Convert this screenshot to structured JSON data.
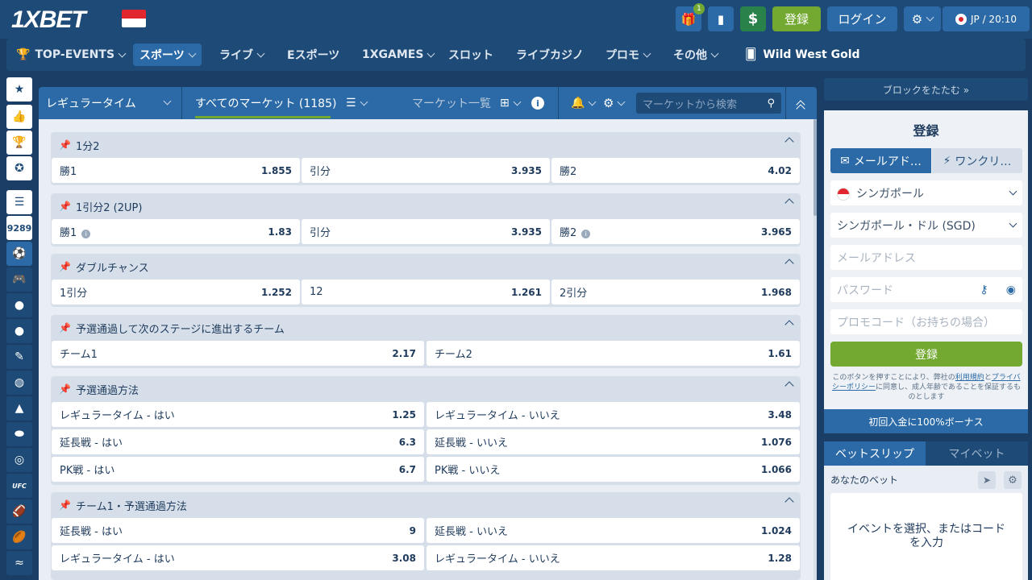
{
  "header": {
    "logo": "1XBET",
    "gift_badge": "1",
    "dollar_icon": "$",
    "register": "登録",
    "login": "ログイン",
    "lang": "JP / 20:10"
  },
  "nav": {
    "items": [
      {
        "label": "TOP-EVENTS"
      },
      {
        "label": "スポーツ"
      },
      {
        "label": "ライブ"
      },
      {
        "label": "Eスポーツ"
      },
      {
        "label": "1XGAMES"
      },
      {
        "label": "スロット"
      },
      {
        "label": "ライブカジノ"
      },
      {
        "label": "プロモ"
      },
      {
        "label": "その他"
      },
      {
        "label": "Wild West Gold"
      }
    ]
  },
  "sidebar": {
    "count": "9289",
    "ufc_label": "UFC"
  },
  "market_header": {
    "period": "レギュラータイム",
    "all_markets": "すべてのマーケット (1185)",
    "market_list": "マーケット一覧",
    "search_placeholder": "マーケットから検索"
  },
  "markets": [
    {
      "title": "1分2",
      "odds": [
        {
          "label": "勝1",
          "value": "1.855"
        },
        {
          "label": "引分",
          "value": "3.935"
        },
        {
          "label": "勝2",
          "value": "4.02"
        }
      ]
    },
    {
      "title": "1引分2 (2UP)",
      "odds": [
        {
          "label": "勝1",
          "value": "1.83"
        },
        {
          "label": "引分",
          "value": "3.935"
        },
        {
          "label": "勝2",
          "value": "3.965"
        }
      ]
    },
    {
      "title": "ダブルチャンス",
      "odds": [
        {
          "label": "1引分",
          "value": "1.252"
        },
        {
          "label": "12",
          "value": "1.261"
        },
        {
          "label": "2引分",
          "value": "1.968"
        }
      ]
    },
    {
      "title": "予選通過して次のステージに進出するチーム",
      "odds": [
        {
          "label": "チーム1",
          "value": "2.17"
        },
        {
          "label": "チーム2",
          "value": "1.61"
        }
      ]
    },
    {
      "title": "予選通過方法",
      "odds": [
        {
          "label": "レギュラータイム - はい",
          "value": "1.25"
        },
        {
          "label": "レギュラータイム - いいえ",
          "value": "3.48"
        },
        {
          "label": "延長戦 - はい",
          "value": "6.3"
        },
        {
          "label": "延長戦 - いいえ",
          "value": "1.076"
        },
        {
          "label": "PK戦 - はい",
          "value": "6.7"
        },
        {
          "label": "PK戦 - いいえ",
          "value": "1.066"
        }
      ]
    },
    {
      "title": "チーム1・予選通過方法",
      "odds": [
        {
          "label": "延長戦 - はい",
          "value": "9"
        },
        {
          "label": "延長戦 - いいえ",
          "value": "1.024"
        },
        {
          "label": "レギュラータイム - はい",
          "value": "3.08"
        },
        {
          "label": "レギュラータイム - いいえ",
          "value": "1.28"
        }
      ]
    }
  ],
  "right": {
    "collapse": "ブロックをたたむ »",
    "reg_title": "登録",
    "tab_email": "メールアド…",
    "tab_oneclick": "ワンクリ…",
    "country": "シンガポール",
    "currency": "シンガポール・ドル (SGD)",
    "email_ph": "メールアドレス",
    "password_ph": "パスワード",
    "promo_ph": "プロモコード（お持ちの場合）",
    "submit": "登録",
    "terms_pre": "このボタンを押すことにより、弊社の",
    "terms_link": "利用規約",
    "terms_and": "と",
    "privacy_link": "プライバシーポリシー",
    "terms_post": "に同意し、成人年齢であることを保証するものとします",
    "bonus": "初回入金に100%ボーナス",
    "betslip_tab": "ベットスリップ",
    "mybet_tab": "マイベット",
    "your_bet": "あなたのベット",
    "empty_msg": "イベントを選択、またはコードを入力"
  }
}
